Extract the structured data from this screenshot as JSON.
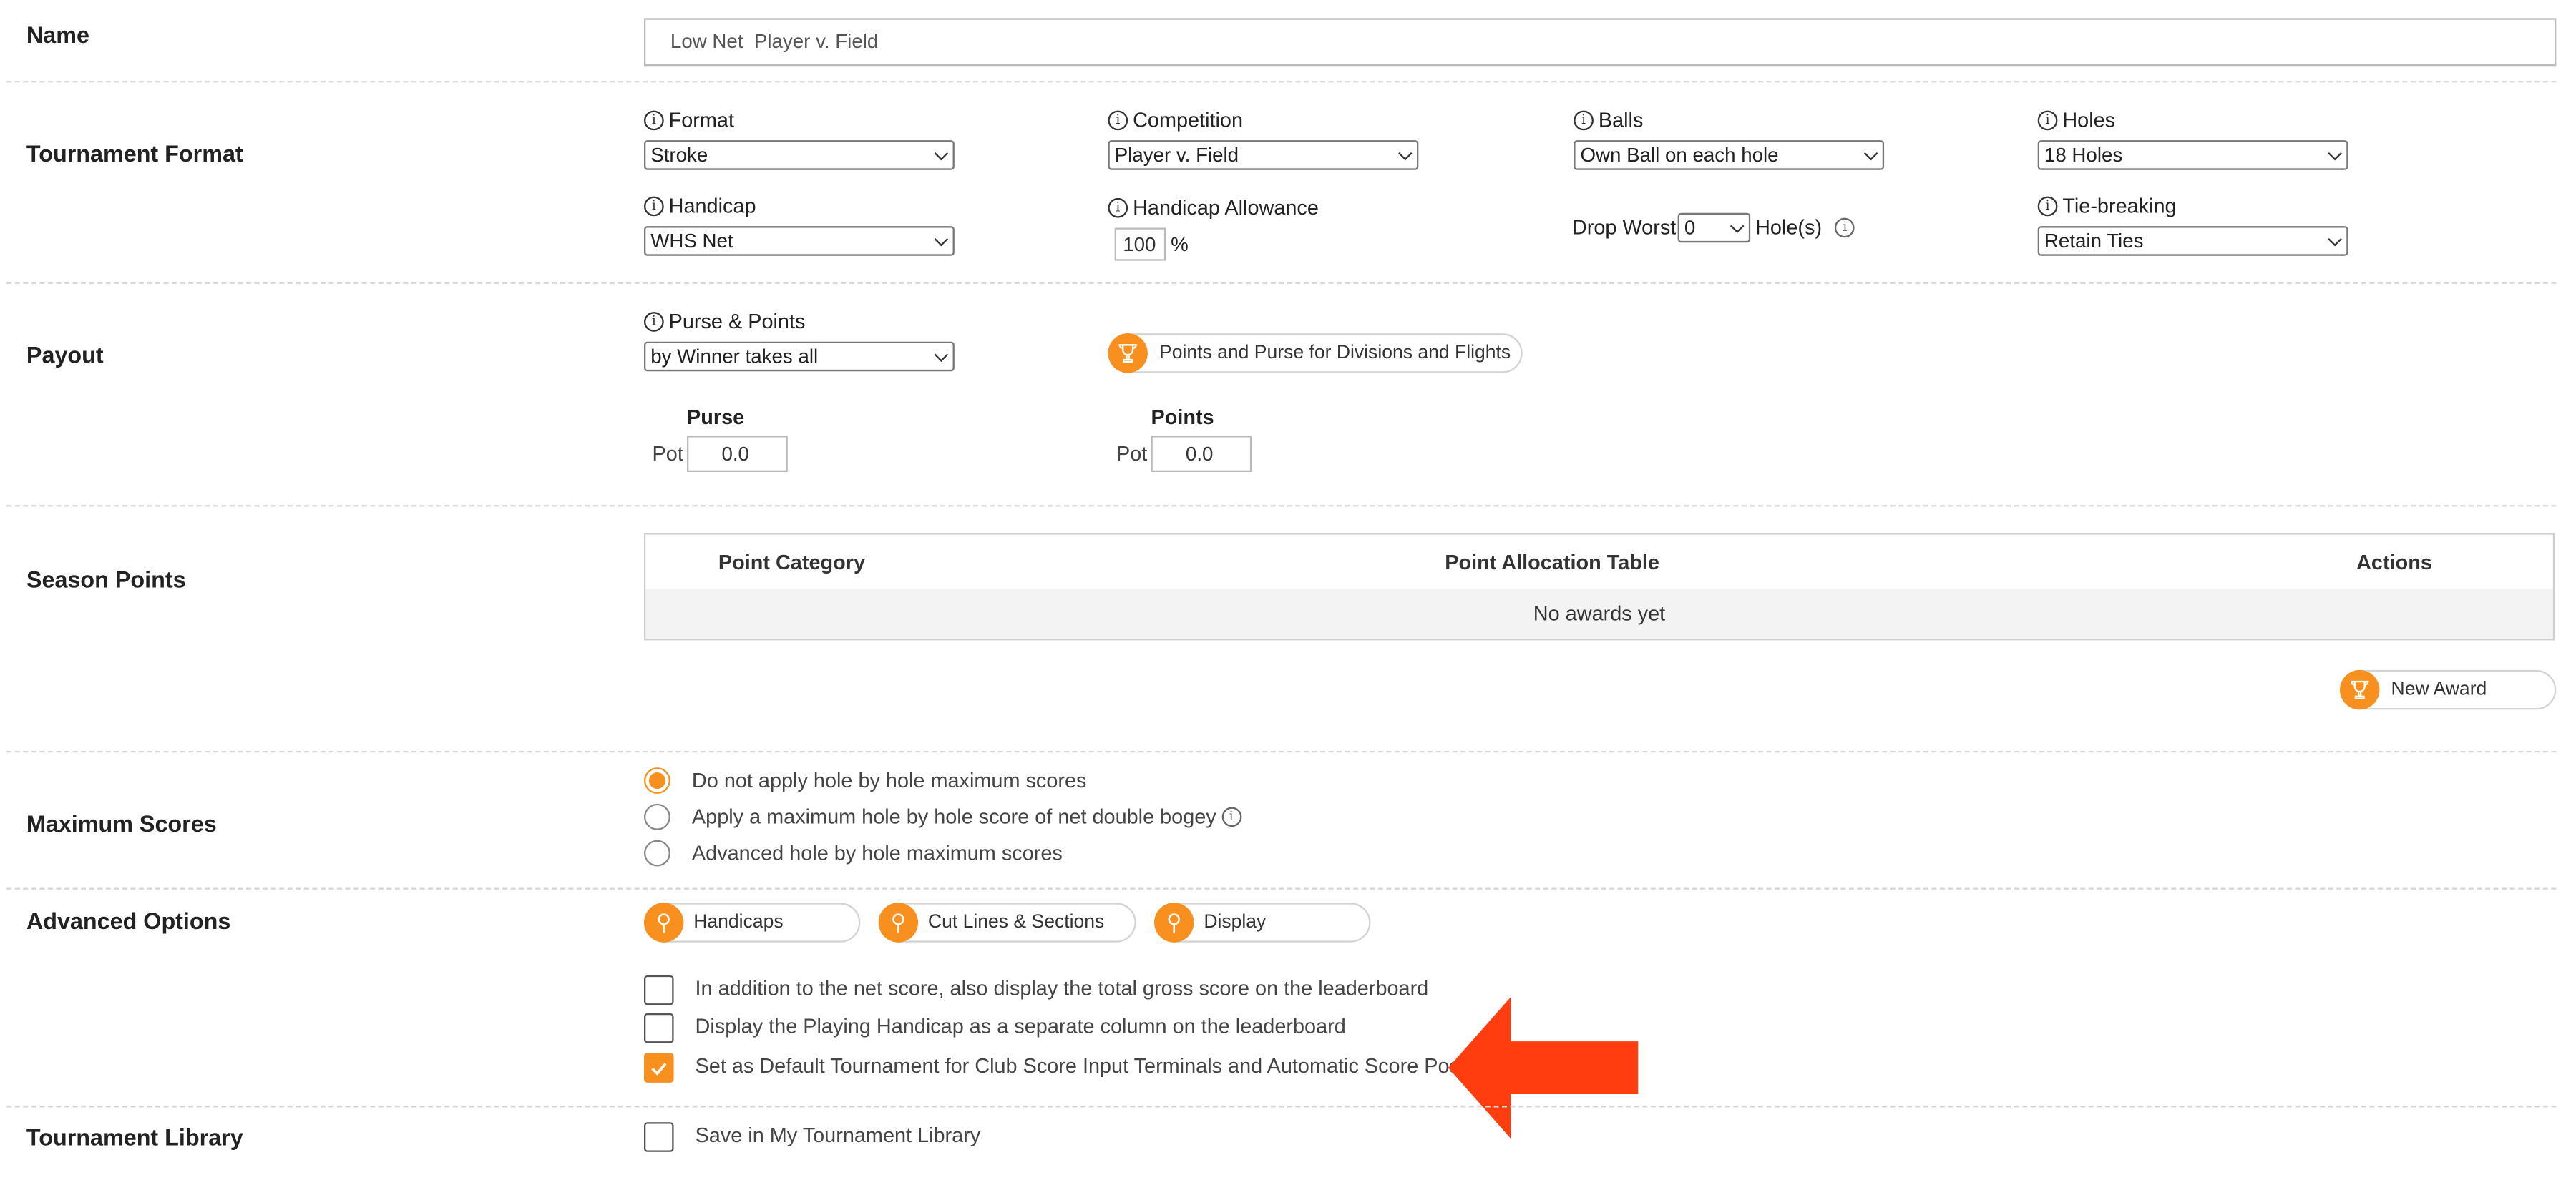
{
  "accent_color": "#f7901e",
  "arrow_color": "#ff3d0f",
  "name": {
    "label": "Name",
    "value": "Low Net  Player v. Field"
  },
  "format": {
    "label": "Tournament Format",
    "format_label": "Format",
    "format_value": "Stroke",
    "competition_label": "Competition",
    "competition_value": "Player v. Field",
    "balls_label": "Balls",
    "balls_value": "Own Ball on each hole",
    "holes_label": "Holes",
    "holes_value": "18 Holes",
    "handicap_label": "Handicap",
    "handicap_value": "WHS Net",
    "allowance_label": "Handicap Allowance",
    "allowance_value": "100",
    "allowance_unit": "%",
    "drop_worst_label": "Drop Worst",
    "drop_worst_value": "0",
    "drop_worst_suffix": "Hole(s)",
    "tiebreak_label": "Tie-breaking",
    "tiebreak_value": "Retain Ties"
  },
  "payout": {
    "label": "Payout",
    "purse_points_label": "Purse & Points",
    "purse_points_value": "by Winner takes all",
    "divisions_button": "Points and Purse for Divisions and Flights",
    "purse_heading": "Purse",
    "purse_pot_label": "Pot",
    "purse_pot_value": "0.0",
    "points_heading": "Points",
    "points_pot_label": "Pot",
    "points_pot_value": "0.0"
  },
  "season_points": {
    "label": "Season Points",
    "columns": [
      "Point Category",
      "Point Allocation Table",
      "Actions"
    ],
    "empty_text": "No awards yet",
    "new_award_button": "New Award"
  },
  "max_scores": {
    "label": "Maximum Scores",
    "options": [
      "Do not apply hole by hole maximum scores",
      "Apply a maximum hole by hole score of net double bogey",
      "Advanced hole by hole maximum scores"
    ]
  },
  "advanced": {
    "label": "Advanced Options",
    "buttons": [
      "Handicaps",
      "Cut Lines & Sections",
      "Display"
    ],
    "checkboxes": [
      "In addition to the net score, also display the total gross score on the leaderboard",
      "Display the Playing Handicap as a separate column on the leaderboard",
      "Set as Default Tournament for Club Score Input Terminals and Automatic Score Posting"
    ]
  },
  "library": {
    "label": "Tournament Library",
    "checkbox": "Save in My Tournament Library"
  }
}
